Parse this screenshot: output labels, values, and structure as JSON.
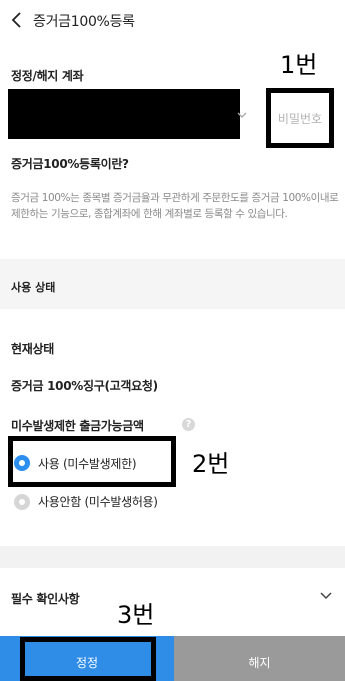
{
  "header": {
    "title": "증거금100%등록"
  },
  "account": {
    "label": "정정/해지 계좌",
    "password_placeholder": "비밀번호"
  },
  "description": {
    "title": "증거금100%등록이란?",
    "text": "증거금 100%는 종목별 증거금율과 무관하게 주문한도를 증거금 100%이내로 제한하는 기능으로, 종합계좌에 한해 계좌별로 등록할 수 있습니다."
  },
  "status": {
    "section_label": "사용 상태",
    "current_label": "현재상태",
    "current_value": "증거금 100%징구(고객요청)",
    "withdraw_label": "미수발생제한 출금가능금액",
    "help_icon": "?",
    "options": [
      {
        "label": "사용 (미수발생제한)",
        "selected": true
      },
      {
        "label": "사용안함 (미수발생허용)",
        "selected": false
      }
    ]
  },
  "checklist": {
    "label": "필수 확인사항"
  },
  "buttons": {
    "modify": "정정",
    "cancel": "해지"
  },
  "annotations": {
    "one": "1번",
    "two": "2번",
    "three": "3번"
  },
  "colors": {
    "primary": "#2f8de8",
    "secondary": "#9a9a9a",
    "radio_on": "#2c8ff0"
  }
}
